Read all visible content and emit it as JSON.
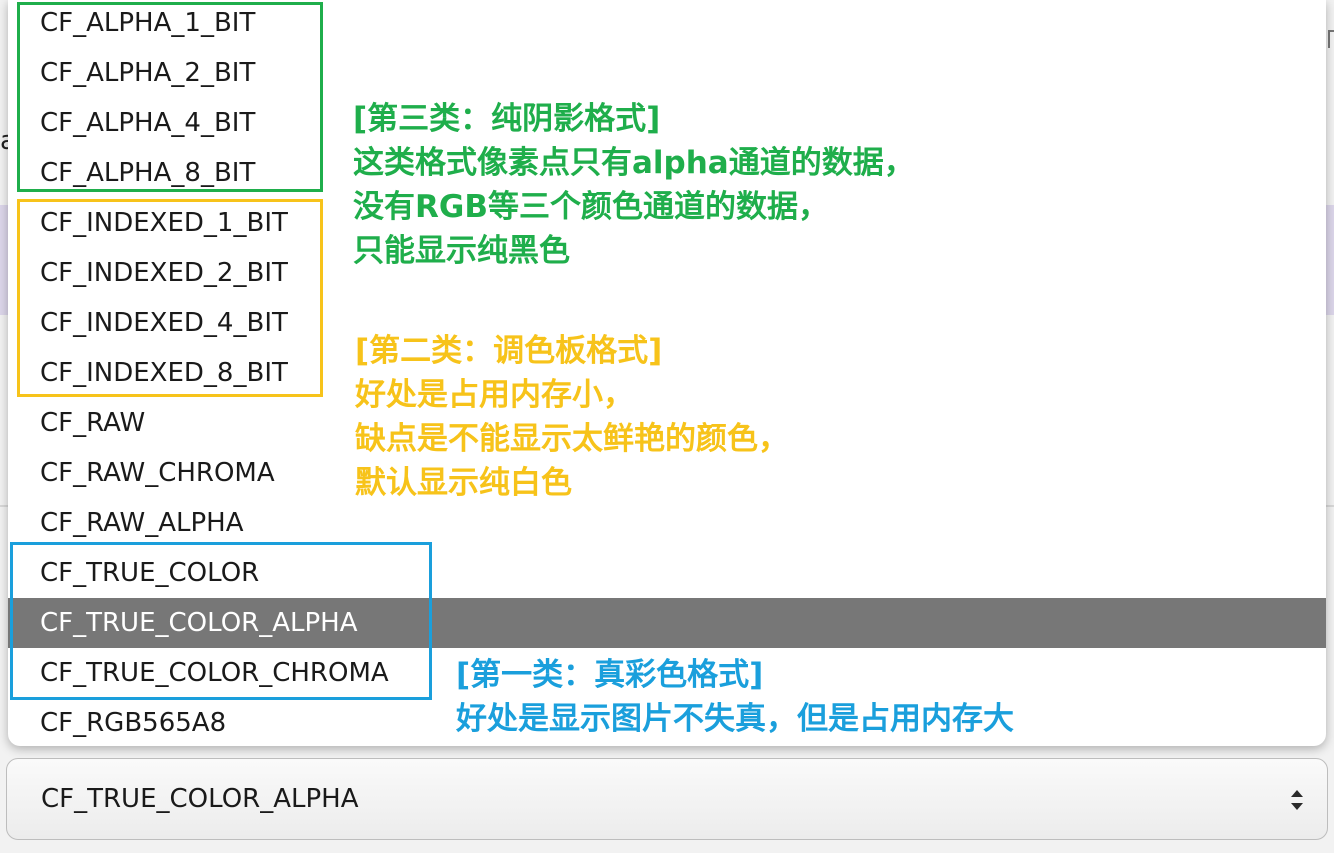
{
  "background": {
    "edge_char": "a"
  },
  "dropdown": {
    "options": [
      "CF_ALPHA_1_BIT",
      "CF_ALPHA_2_BIT",
      "CF_ALPHA_4_BIT",
      "CF_ALPHA_8_BIT",
      "CF_INDEXED_1_BIT",
      "CF_INDEXED_2_BIT",
      "CF_INDEXED_4_BIT",
      "CF_INDEXED_8_BIT",
      "CF_RAW",
      "CF_RAW_CHROMA",
      "CF_RAW_ALPHA",
      "CF_TRUE_COLOR",
      "CF_TRUE_COLOR_ALPHA",
      "CF_TRUE_COLOR_CHROMA",
      "CF_RGB565A8"
    ],
    "selected_index": 12
  },
  "annotations": {
    "alpha": {
      "color": "#1fae4b",
      "lines": [
        "[第三类：纯阴影格式]",
        "这类格式像素点只有alpha通道的数据，",
        "没有RGB等三个颜色通道的数据，",
        "只能显示纯黑色"
      ]
    },
    "indexed": {
      "color": "#f7c31a",
      "lines": [
        "[第二类：调色板格式]",
        "好处是占用内存小，",
        "缺点是不能显示太鲜艳的颜色，",
        "默认显示纯白色"
      ]
    },
    "true_color": {
      "color": "#1a9fdc",
      "lines": [
        "[第一类：真彩色格式]",
        "好处是显示图片不失真，但是占用内存大"
      ]
    }
  },
  "select": {
    "value": "CF_TRUE_COLOR_ALPHA",
    "icon": "up-down-arrows-icon"
  }
}
